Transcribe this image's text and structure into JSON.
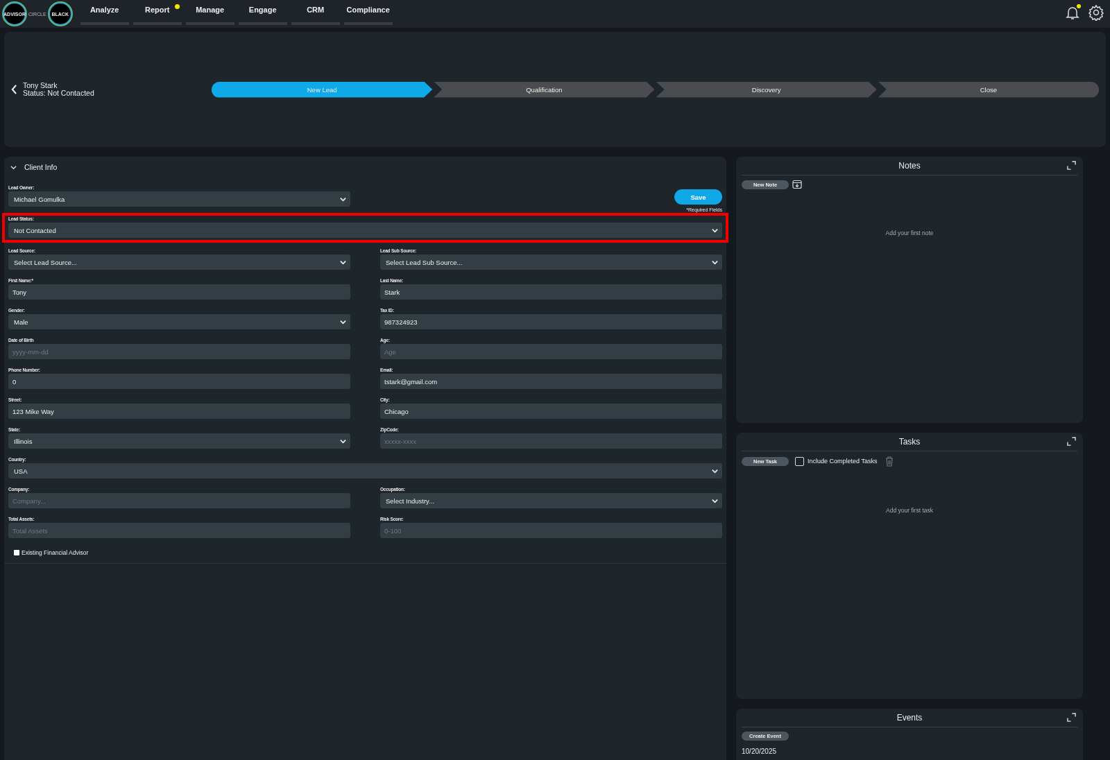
{
  "logo": {
    "badge": "ADVISOR",
    "word": "CIRCLE",
    "badge2": "BLACK"
  },
  "nav": [
    {
      "label": "Analyze",
      "dot": false
    },
    {
      "label": "Report",
      "dot": true
    },
    {
      "label": "Manage",
      "dot": false
    },
    {
      "label": "Engage",
      "dot": false
    },
    {
      "label": "CRM",
      "dot": false
    },
    {
      "label": "Compliance",
      "dot": false
    }
  ],
  "notifications": {
    "dot": true
  },
  "lead": {
    "name": "Tony Stark",
    "status": "Status: Not Contacted"
  },
  "stages": [
    {
      "label": "New Lead",
      "selected": true
    },
    {
      "label": "Qualification",
      "selected": false
    },
    {
      "label": "Discovery",
      "selected": false
    },
    {
      "label": "Close",
      "selected": false
    }
  ],
  "client_info": {
    "title": "Client Info",
    "expanded": true,
    "owner_field": {
      "label": "Lead Owner:",
      "kind": "select",
      "value": "Michael Gomulka"
    },
    "save_button": "Save",
    "required_note": "*Required Fields",
    "fields": [
      {
        "label": "Lead Status:",
        "kind": "select",
        "value": "Not Contacted",
        "wide": true,
        "highlighted": true
      },
      {
        "label": "Lead Source:",
        "kind": "select",
        "value": "Select Lead Source..."
      },
      {
        "label": "Lead Sub Source:",
        "kind": "select",
        "value": "Select Lead Sub Source..."
      },
      {
        "label": "First Name:*",
        "kind": "input",
        "value": "Tony"
      },
      {
        "label": "Last Name:",
        "kind": "input",
        "value": "Stark"
      },
      {
        "label": "Gender:",
        "kind": "select",
        "value": "Male"
      },
      {
        "label": "Tax ID:",
        "kind": "input",
        "value": "987324923"
      },
      {
        "label": "Date of Birth",
        "kind": "input",
        "placeholder": "yyyy-mm-dd"
      },
      {
        "label": "Age:",
        "kind": "input",
        "placeholder": "Age"
      },
      {
        "label": "Phone Number:",
        "kind": "input",
        "value": "0"
      },
      {
        "label": "Email:",
        "kind": "input",
        "value": "tstark@gmail.com"
      },
      {
        "label": "Street:",
        "kind": "input",
        "value": "123 Mike Way"
      },
      {
        "label": "City:",
        "kind": "input",
        "value": "Chicago"
      },
      {
        "label": "State:",
        "kind": "select",
        "value": "Illinois"
      },
      {
        "label": "ZipCode:",
        "kind": "input",
        "placeholder": "xxxxx-xxxx"
      },
      {
        "label": "Country:",
        "kind": "select",
        "value": "USA",
        "wide": true
      },
      {
        "label": "Company:",
        "kind": "input",
        "placeholder": "Company..."
      },
      {
        "label": "Occupation:",
        "kind": "select",
        "value": "Select Industry..."
      },
      {
        "label": "Total Assets:",
        "kind": "input",
        "placeholder": "Total Assets"
      },
      {
        "label": "Risk Score:",
        "kind": "input",
        "placeholder": "0-100"
      }
    ],
    "checkbox": {
      "label": "Existing Financial Advisor",
      "checked": false
    }
  },
  "notes": {
    "title": "Notes",
    "button": "New Note",
    "empty": "Add your first note"
  },
  "tasks": {
    "title": "Tasks",
    "button": "New Task",
    "include_completed": {
      "label": "Include Completed Tasks",
      "checked": false
    },
    "empty": "Add your first task"
  },
  "events": {
    "title": "Events",
    "button": "Create Event",
    "dates": [
      "10/20/2025"
    ]
  }
}
